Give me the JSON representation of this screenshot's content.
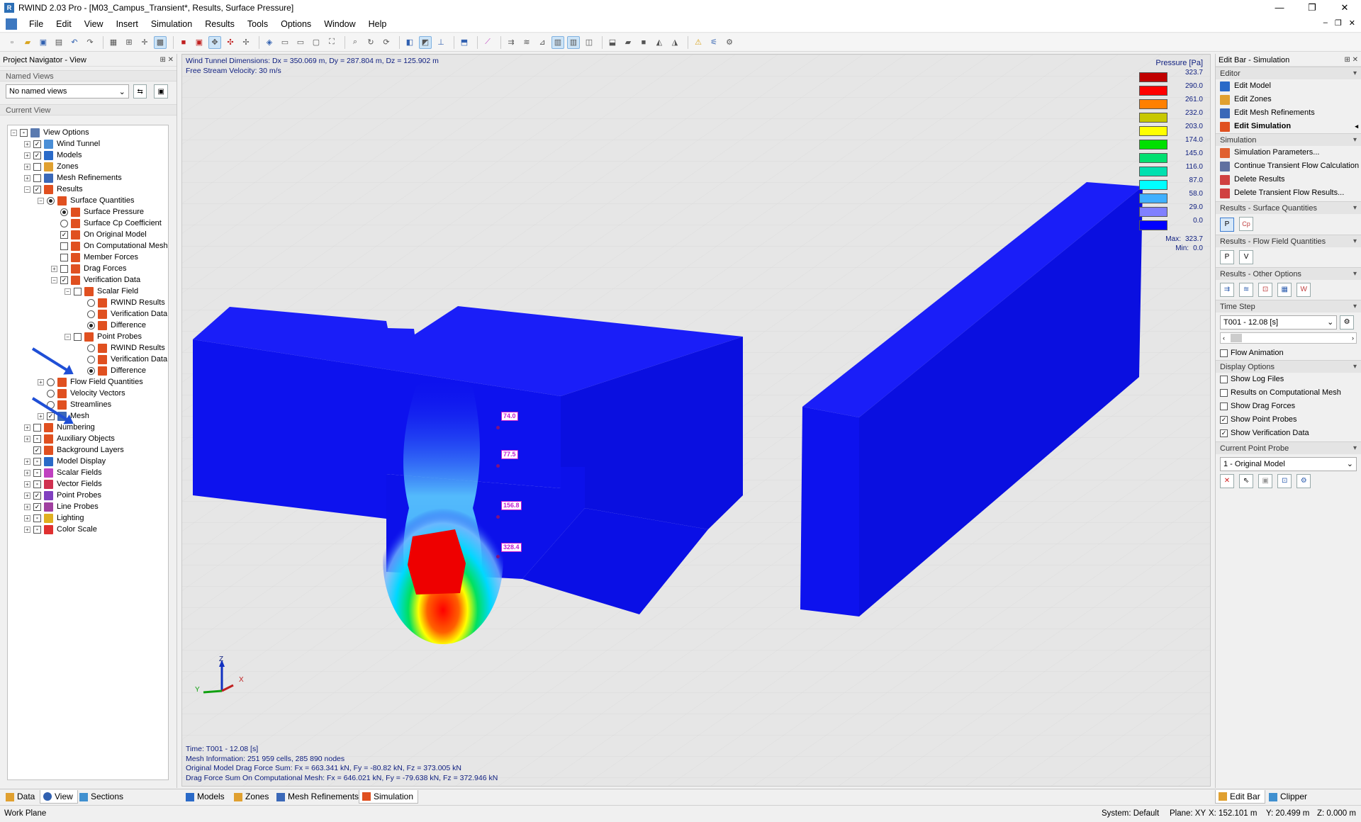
{
  "window": {
    "title": "RWIND 2.03 Pro - [M03_Campus_Transient*, Results, Surface Pressure]",
    "app_icon": "rwind-app-icon",
    "buttons": [
      "—",
      "❐",
      "✕"
    ],
    "mdi_buttons": [
      "–",
      "❐",
      "✕"
    ]
  },
  "menu": [
    "File",
    "Edit",
    "View",
    "Insert",
    "Simulation",
    "Results",
    "Tools",
    "Options",
    "Window",
    "Help"
  ],
  "navigator": {
    "title": "Project Navigator - View",
    "named_views_header": "Named Views",
    "named_views_value": "No named views",
    "current_view_header": "Current View",
    "tree": [
      {
        "label": "View Options",
        "indent": 0,
        "exp": "-",
        "ctrl": "cb",
        "state": "p",
        "icon": "#5a7ab0"
      },
      {
        "label": "Wind Tunnel",
        "indent": 1,
        "exp": "+",
        "ctrl": "cb",
        "state": "c",
        "icon": "#4a8ed6"
      },
      {
        "label": "Models",
        "indent": 1,
        "exp": "+",
        "ctrl": "cb",
        "state": "c",
        "icon": "#2a6ac8"
      },
      {
        "label": "Zones",
        "indent": 1,
        "exp": "+",
        "ctrl": "cb",
        "state": "",
        "icon": "#e0a030"
      },
      {
        "label": "Mesh Refinements",
        "indent": 1,
        "exp": "+",
        "ctrl": "cb",
        "state": "",
        "icon": "#3a68b8"
      },
      {
        "label": "Results",
        "indent": 1,
        "exp": "-",
        "ctrl": "cb",
        "state": "c",
        "icon": "#e05020"
      },
      {
        "label": "Surface Quantities",
        "indent": 2,
        "exp": "-",
        "ctrl": "rb",
        "state": "on",
        "icon": "#e05020"
      },
      {
        "label": "Surface Pressure",
        "indent": 3,
        "exp": "",
        "ctrl": "rb",
        "state": "on",
        "icon": "#e05020"
      },
      {
        "label": "Surface Cp Coefficient",
        "indent": 3,
        "exp": "",
        "ctrl": "rb",
        "state": "",
        "icon": "#e05020"
      },
      {
        "label": "On Original Model",
        "indent": 3,
        "exp": "",
        "ctrl": "cb",
        "state": "c",
        "icon": "#e05020"
      },
      {
        "label": "On Computational Mesh",
        "indent": 3,
        "exp": "",
        "ctrl": "cb",
        "state": "",
        "icon": "#e05020"
      },
      {
        "label": "Member Forces",
        "indent": 3,
        "exp": "",
        "ctrl": "cb",
        "state": "",
        "icon": "#e05020"
      },
      {
        "label": "Drag Forces",
        "indent": 3,
        "exp": "+",
        "ctrl": "cb",
        "state": "",
        "icon": "#e05020"
      },
      {
        "label": "Verification Data",
        "indent": 3,
        "exp": "-",
        "ctrl": "cb",
        "state": "c",
        "icon": "#e05020"
      },
      {
        "label": "Scalar Field",
        "indent": 4,
        "exp": "-",
        "ctrl": "cb",
        "state": "",
        "icon": "#e05020"
      },
      {
        "label": "RWIND Results",
        "indent": 5,
        "exp": "",
        "ctrl": "rb",
        "state": "",
        "icon": "#e05020"
      },
      {
        "label": "Verification Data",
        "indent": 5,
        "exp": "",
        "ctrl": "rb",
        "state": "",
        "icon": "#e05020"
      },
      {
        "label": "Difference",
        "indent": 5,
        "exp": "",
        "ctrl": "rb",
        "state": "on",
        "icon": "#e05020"
      },
      {
        "label": "Point Probes",
        "indent": 4,
        "exp": "-",
        "ctrl": "cb",
        "state": "",
        "icon": "#e05020"
      },
      {
        "label": "RWIND Results",
        "indent": 5,
        "exp": "",
        "ctrl": "rb",
        "state": "",
        "icon": "#e05020"
      },
      {
        "label": "Verification Data",
        "indent": 5,
        "exp": "",
        "ctrl": "rb",
        "state": "",
        "icon": "#e05020"
      },
      {
        "label": "Difference",
        "indent": 5,
        "exp": "",
        "ctrl": "rb",
        "state": "on",
        "icon": "#e05020"
      },
      {
        "label": "Flow Field Quantities",
        "indent": 2,
        "exp": "+",
        "ctrl": "rb",
        "state": "",
        "icon": "#e05020"
      },
      {
        "label": "Velocity Vectors",
        "indent": 2,
        "exp": "",
        "ctrl": "rb",
        "state": "",
        "icon": "#e05020"
      },
      {
        "label": "Streamlines",
        "indent": 2,
        "exp": "",
        "ctrl": "rb",
        "state": "",
        "icon": "#e05020"
      },
      {
        "label": "Mesh",
        "indent": 2,
        "exp": "+",
        "ctrl": "cb",
        "state": "c",
        "icon": "#3a68b8"
      },
      {
        "label": "Numbering",
        "indent": 1,
        "exp": "+",
        "ctrl": "cb",
        "state": "",
        "icon": "#e05020"
      },
      {
        "label": "Auxiliary Objects",
        "indent": 1,
        "exp": "+",
        "ctrl": "cb",
        "state": "p",
        "icon": "#e05020"
      },
      {
        "label": "Background Layers",
        "indent": 1,
        "exp": "",
        "ctrl": "cb",
        "state": "c",
        "icon": "#e05020"
      },
      {
        "label": "Model Display",
        "indent": 1,
        "exp": "+",
        "ctrl": "cb",
        "state": "p",
        "icon": "#2a6ac8"
      },
      {
        "label": "Scalar Fields",
        "indent": 1,
        "exp": "+",
        "ctrl": "cb",
        "state": "p",
        "icon": "#c040c0"
      },
      {
        "label": "Vector Fields",
        "indent": 1,
        "exp": "+",
        "ctrl": "cb",
        "state": "p",
        "icon": "#d03050"
      },
      {
        "label": "Point Probes",
        "indent": 1,
        "exp": "+",
        "ctrl": "cb",
        "state": "c",
        "icon": "#8040c0"
      },
      {
        "label": "Line Probes",
        "indent": 1,
        "exp": "+",
        "ctrl": "cb",
        "state": "c",
        "icon": "#a040a0"
      },
      {
        "label": "Lighting",
        "indent": 1,
        "exp": "+",
        "ctrl": "cb",
        "state": "p",
        "icon": "#e0b020"
      },
      {
        "label": "Color Scale",
        "indent": 1,
        "exp": "+",
        "ctrl": "cb",
        "state": "p",
        "icon": "#e03030"
      }
    ]
  },
  "viewport": {
    "info_top": [
      "Wind Tunnel Dimensions: Dx = 350.069 m, Dy = 287.804 m, Dz = 125.902 m",
      "Free Stream Velocity: 30 m/s"
    ],
    "info_bottom": [
      "Time: T001 - 12.08 [s]",
      "Mesh Information: 251 959 cells, 285 890 nodes",
      "Original Model Drag Force Sum: Fx = 663.341 kN, Fy = -80.82 kN, Fz = 373.005 kN",
      "Drag Force Sum On Computational Mesh: Fx = 646.021 kN, Fy = -79.638 kN, Fz = 372.946 kN"
    ],
    "legend_title": "Pressure [Pa]",
    "legend": [
      {
        "color": "#c00000",
        "value": "323.7"
      },
      {
        "color": "#ff0000",
        "value": "290.0"
      },
      {
        "color": "#ff8000",
        "value": "261.0"
      },
      {
        "color": "#c8c800",
        "value": "232.0"
      },
      {
        "color": "#ffff00",
        "value": "203.0"
      },
      {
        "color": "#00e000",
        "value": "174.0"
      },
      {
        "color": "#00e070",
        "value": "145.0"
      },
      {
        "color": "#00e0b0",
        "value": "116.0"
      },
      {
        "color": "#00ffff",
        "value": "87.0"
      },
      {
        "color": "#40b0ff",
        "value": "58.0"
      },
      {
        "color": "#8080ff",
        "value": "29.0"
      },
      {
        "color": "#0000ff",
        "value": "0.0"
      }
    ],
    "max_label": "Max:",
    "max_value": "323.7",
    "min_label": "Min:",
    "min_value": "0.0",
    "probes": [
      "74.0",
      "77.5",
      "156.8",
      "328.4"
    ],
    "axes": {
      "z": "Z",
      "x": "X",
      "y": "Y"
    }
  },
  "editbar": {
    "title": "Edit Bar - Simulation",
    "editor_header": "Editor",
    "editor_items": [
      "Edit Model",
      "Edit Zones",
      "Edit Mesh Refinements",
      "Edit Simulation"
    ],
    "simulation_header": "Simulation",
    "simulation_items": [
      "Simulation Parameters...",
      "Continue Transient Flow Calculation",
      "Delete Results",
      "Delete Transient Flow Results..."
    ],
    "surface_header": "Results - Surface Quantities",
    "surface_buttons": [
      "P",
      "Cp"
    ],
    "flow_header": "Results - Flow Field Quantities",
    "flow_buttons": [
      "P",
      "V"
    ],
    "other_header": "Results - Other Options",
    "timestep_header": "Time Step",
    "timestep_value": "T001 - 12.08 [s]",
    "flow_animation": "Flow Animation",
    "display_header": "Display Options",
    "display_items": [
      {
        "label": "Show Log Files",
        "checked": false
      },
      {
        "label": "Results on Computational Mesh",
        "checked": false
      },
      {
        "label": "Show Drag Forces",
        "checked": false
      },
      {
        "label": "Show Point Probes",
        "checked": true
      },
      {
        "label": "Show Verification Data",
        "checked": true
      }
    ],
    "probe_header": "Current Point Probe",
    "probe_value": "1 - Original Model"
  },
  "bottom_tabs_left": [
    "Data",
    "View",
    "Sections"
  ],
  "bottom_tabs_center": [
    "Models",
    "Zones",
    "Mesh Refinements",
    "Simulation"
  ],
  "bottom_tabs_right": [
    "Edit Bar",
    "Clipper"
  ],
  "status": {
    "left": "Work Plane",
    "system": "System: Default",
    "plane": "Plane: XY",
    "x": "X: 152.101 m",
    "y": "Y: 20.499 m",
    "z": "Z: 0.000 m"
  },
  "colors": {
    "model_blue": "#0f14f0",
    "background": "#e6e6e6",
    "accent": "#1f4fd6"
  }
}
